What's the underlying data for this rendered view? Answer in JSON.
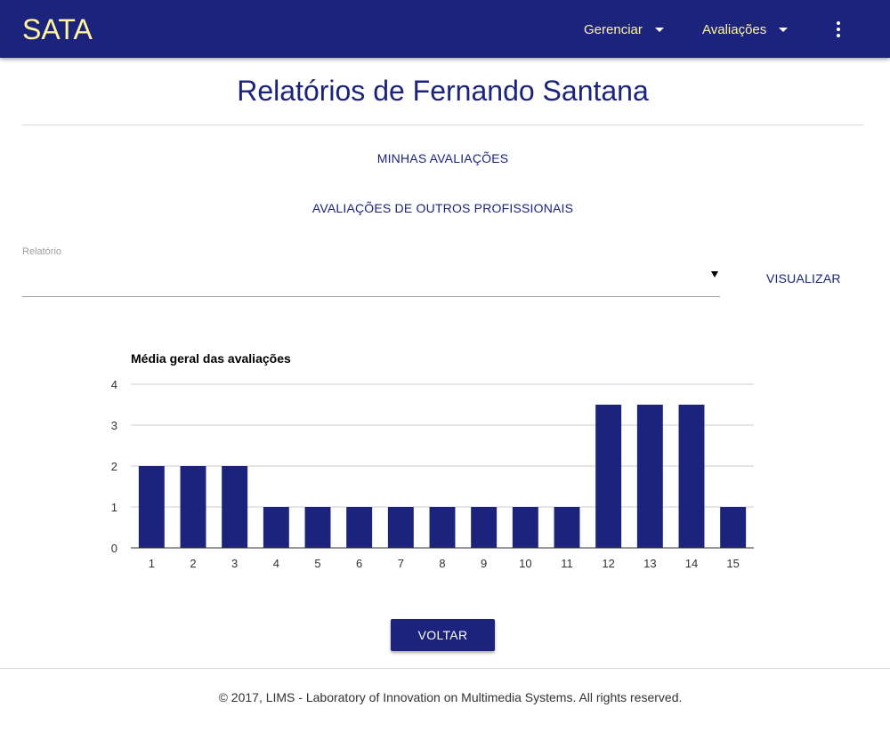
{
  "header": {
    "brand": "SATA",
    "menus": [
      {
        "label": "Gerenciar"
      },
      {
        "label": "Avaliações"
      }
    ]
  },
  "main": {
    "title": "Relatórios de Fernando Santana",
    "tabs": [
      {
        "label": "MINHAS AVALIAÇÕES"
      },
      {
        "label": "AVALIAÇÕES DE OUTROS PROFISSIONAIS"
      }
    ],
    "report_select": {
      "label": "Relatório",
      "value": ""
    },
    "visualizar_label": "VISUALIZAR",
    "voltar_label": "VOLTAR"
  },
  "chart_data": {
    "type": "bar",
    "title": "Média geral das avaliações",
    "xlabel": "",
    "ylabel": "",
    "categories": [
      "1",
      "2",
      "3",
      "4",
      "5",
      "6",
      "7",
      "8",
      "9",
      "10",
      "11",
      "12",
      "13",
      "14",
      "15"
    ],
    "values": [
      2,
      2,
      2,
      1,
      1,
      1,
      1,
      1,
      1,
      1,
      1,
      3.5,
      3.5,
      3.5,
      1
    ],
    "ylim": [
      0,
      4
    ],
    "yticks": [
      0,
      1,
      2,
      3,
      4
    ],
    "grid": true,
    "legend": "none",
    "bar_color": "#1b237d"
  },
  "footer": {
    "text": "© 2017, LIMS - Laboratory of Innovation on Multimedia Systems. All rights reserved."
  },
  "colors": {
    "primary": "#1b237d",
    "accent": "#fff59d"
  }
}
